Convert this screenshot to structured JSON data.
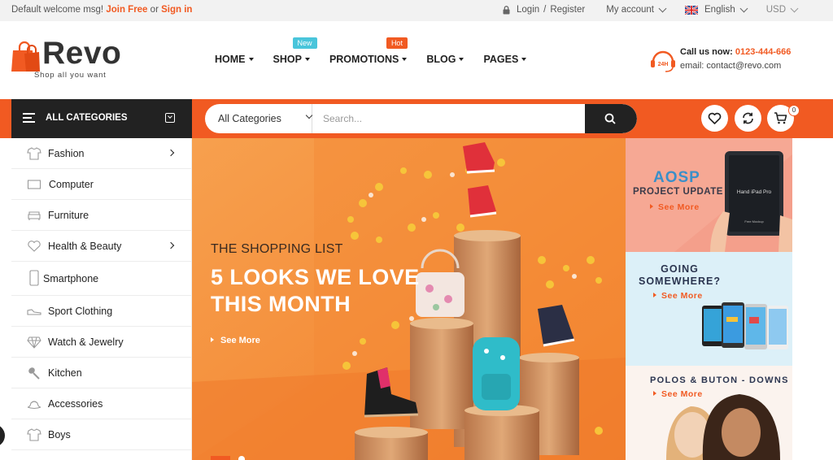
{
  "topbar": {
    "welcome": "Default welcome msg!",
    "join": "Join Free",
    "or": "or",
    "signin": "Sign in",
    "login": "Login",
    "slash": "/",
    "register": "Register",
    "account": "My account",
    "language": "English",
    "currency": "USD"
  },
  "brand": {
    "name": "Revo",
    "tagline": "Shop all you want"
  },
  "nav": [
    {
      "label": "HOME"
    },
    {
      "label": "SHOP",
      "badge": "New"
    },
    {
      "label": "PROMOTIONS",
      "badge": "Hot"
    },
    {
      "label": "BLOG"
    },
    {
      "label": "PAGES"
    }
  ],
  "contact": {
    "call_label": "Call us now:",
    "phone": "0123-444-666",
    "email": "email: contact@revo.com",
    "badge": "24H"
  },
  "bar": {
    "all_categories": "ALL CATEGORIES",
    "select_value": "All Categories",
    "search_placeholder": "Search...",
    "cart_count": "0"
  },
  "categories": [
    {
      "label": "Fashion",
      "icon": "shirt-icon",
      "submenu": true
    },
    {
      "label": "Computer",
      "icon": "monitor-icon",
      "submenu": false
    },
    {
      "label": "Furniture",
      "icon": "sofa-icon",
      "submenu": false
    },
    {
      "label": "Health & Beauty",
      "icon": "heart-icon",
      "submenu": true
    },
    {
      "label": "Smartphone",
      "icon": "smartphone-icon",
      "submenu": false
    },
    {
      "label": "Sport Clothing",
      "icon": "sneaker-icon",
      "submenu": false
    },
    {
      "label": "Watch & Jewelry",
      "icon": "diamond-icon",
      "submenu": false
    },
    {
      "label": "Kitchen",
      "icon": "spatula-icon",
      "submenu": false
    },
    {
      "label": "Accessories",
      "icon": "hat-icon",
      "submenu": false
    },
    {
      "label": "Boys",
      "icon": "shirt-icon",
      "submenu": false
    }
  ],
  "banner": {
    "kicker": "THE SHOPPING LIST",
    "headline": "5 LOOKS WE LOVE\nTHIS MONTH",
    "see_more": "See More"
  },
  "promos": [
    {
      "title": "AOSP",
      "subtitle": "PROJECT UPDATE",
      "see_more": "See More",
      "device_text": "Hand iPad Pro",
      "device_subtext": "Free Mockup"
    },
    {
      "title": "GOING SOMEWHERE?",
      "see_more": "See More"
    },
    {
      "title": "POLOS & BUTON - DOWNS",
      "see_more": "See More"
    }
  ],
  "colors": {
    "accent": "#f15a22",
    "dark": "#222222",
    "banner_bg": "#f58d3b",
    "promo_blue": "#dcf0f8"
  }
}
